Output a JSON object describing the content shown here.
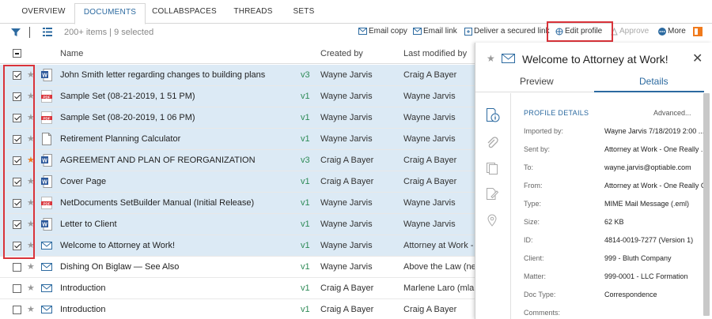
{
  "tabs": [
    {
      "label": "OVERVIEW"
    },
    {
      "label": "DOCUMENTS"
    },
    {
      "label": "COLLABSPACES"
    },
    {
      "label": "THREADS"
    },
    {
      "label": "SETS"
    }
  ],
  "toolbar": {
    "count": "200+ items  |  9 selected",
    "email_copy": "Email copy",
    "email_link": "Email link",
    "deliver": "Deliver a secured link",
    "edit_profile": "Edit profile",
    "approve": "Approve",
    "more": "More"
  },
  "columns": {
    "name": "Name",
    "created": "Created by",
    "modified": "Last modified by"
  },
  "rows": [
    {
      "name": "John Smith letter regarding changes to building plans",
      "version": "v3",
      "created": "Wayne Jarvis",
      "modified": "Craig A Bayer"
    },
    {
      "name": "Sample Set (08-21-2019, 1 51 PM)",
      "version": "v1",
      "created": "Wayne Jarvis",
      "modified": "Wayne Jarvis"
    },
    {
      "name": "Sample Set (08-20-2019, 1 06 PM)",
      "version": "v1",
      "created": "Wayne Jarvis",
      "modified": "Wayne Jarvis"
    },
    {
      "name": "Retirement Planning Calculator",
      "version": "v1",
      "created": "Wayne Jarvis",
      "modified": "Wayne Jarvis"
    },
    {
      "name": "AGREEMENT AND PLAN OF REORGANIZATION",
      "version": "v3",
      "created": "Craig A Bayer",
      "modified": "Craig A Bayer"
    },
    {
      "name": "Cover Page",
      "version": "v1",
      "created": "Craig A Bayer",
      "modified": "Craig A Bayer"
    },
    {
      "name": "NetDocuments SetBuilder Manual (Initial Release)",
      "version": "v1",
      "created": "Wayne Jarvis",
      "modified": "Wayne Jarvis"
    },
    {
      "name": "Letter to Client",
      "version": "v1",
      "created": "Wayne Jarvis",
      "modified": "Wayne Jarvis"
    },
    {
      "name": "Welcome to Attorney at Work!",
      "version": "v1",
      "created": "Wayne Jarvis",
      "modified": "Attorney at Work - ..."
    },
    {
      "name": "Dishing On Biglaw — See Also",
      "version": "v1",
      "created": "Wayne Jarvis",
      "modified": "Above the Law (ne..."
    },
    {
      "name": "Introduction",
      "version": "v1",
      "created": "Craig A Bayer",
      "modified": "Marlene Laro (mlar..."
    },
    {
      "name": "Introduction",
      "version": "v1",
      "created": "Craig A Bayer",
      "modified": "Craig A Bayer"
    }
  ],
  "panel": {
    "title": "Welcome to Attorney at Work!",
    "tab_preview": "Preview",
    "tab_details": "Details",
    "section_title": "PROFILE DETAILS",
    "advanced": "Advanced...",
    "fields": [
      {
        "label": "Imported by:",
        "value": "Wayne Jarvis 7/18/2019 2:00 ..."
      },
      {
        "label": "Sent by:",
        "value": "Attorney at Work - One Really ..."
      },
      {
        "label": "To:",
        "value": "wayne.jarvis@optiable.com"
      },
      {
        "label": "From:",
        "value": "Attorney at Work - One Really G"
      },
      {
        "label": "Type:",
        "value": "MIME Mail Message (.eml)"
      },
      {
        "label": "Size:",
        "value": "62 KB"
      },
      {
        "label": "ID:",
        "value": "4814-0019-7277 (Version 1)"
      },
      {
        "label": "Client:",
        "value": "999 - Bluth Company"
      },
      {
        "label": "Matter:",
        "value": "999-0001 - LLC Formation"
      },
      {
        "label": "Doc Type:",
        "value": "Correspondence"
      },
      {
        "label": "Comments:",
        "value": ""
      }
    ]
  },
  "colors": {
    "accent": "#2c6aa0",
    "selected_row": "#dceaf5",
    "highlight": "#d9333a",
    "orange": "#f07a1c",
    "version": "#2e8b57"
  }
}
